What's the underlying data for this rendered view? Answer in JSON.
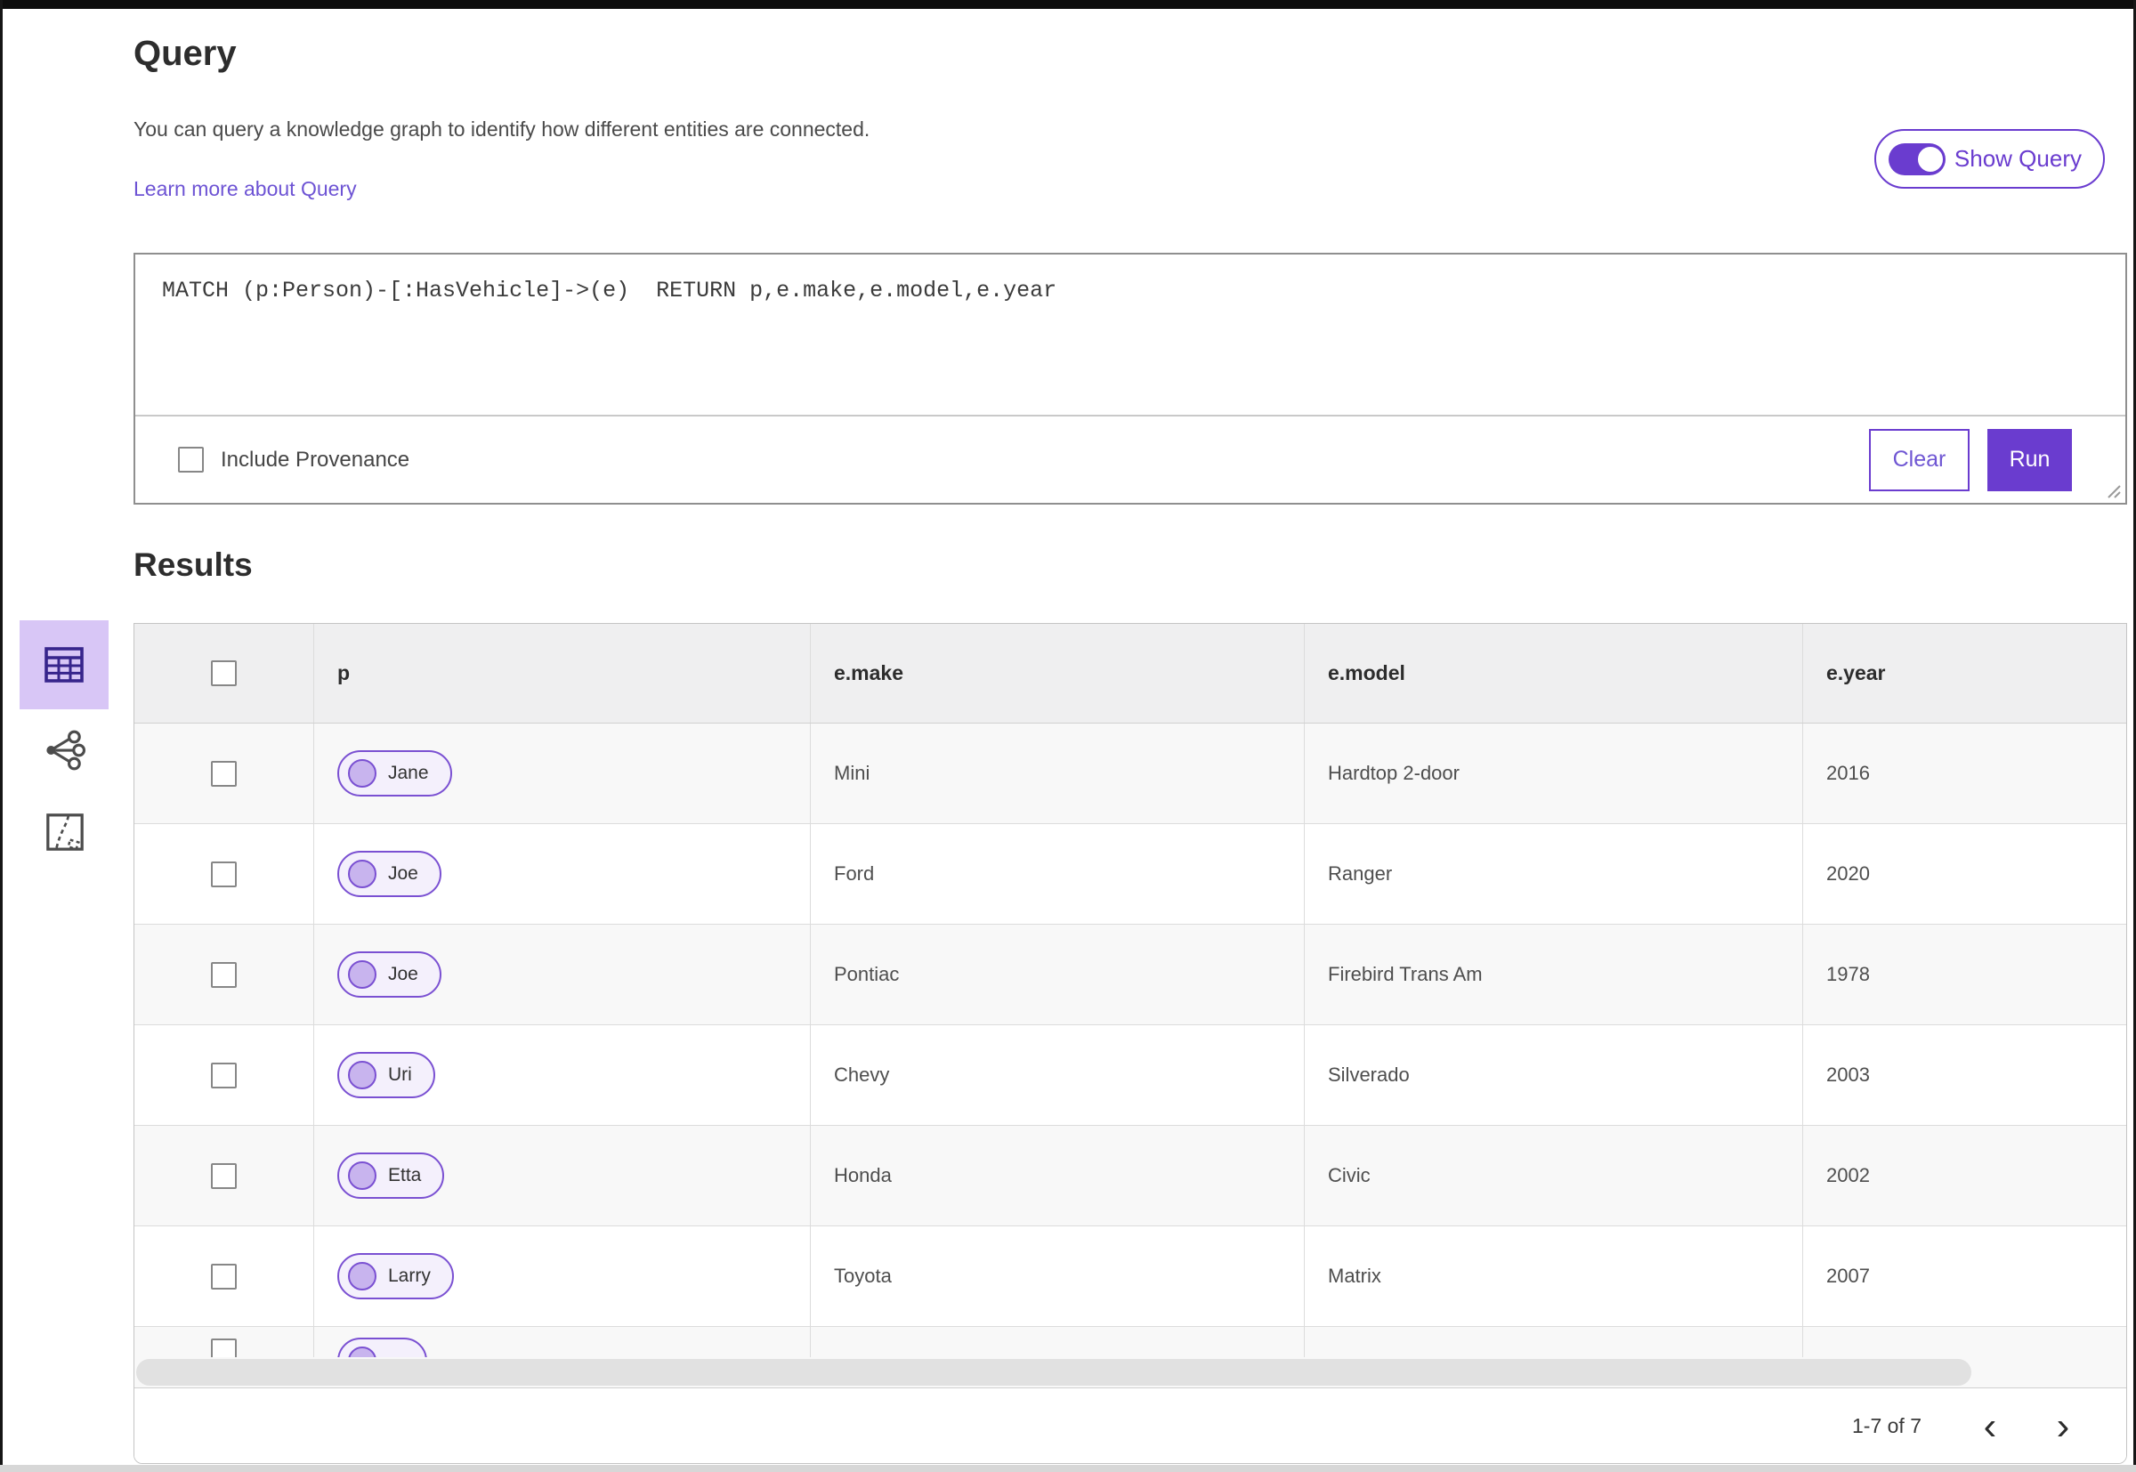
{
  "colors": {
    "accent_purple": "#6a3ccf",
    "pill_border_purple": "#7a50d2",
    "pill_fill": "#f4f0fc",
    "pill_dot_fill": "#c8b4ee",
    "selected_tile_bg": "#d8c6f6",
    "header_bg": "#efeff0",
    "zebra_row_bg": "#f8f8f8"
  },
  "query_panel": {
    "title": "Query",
    "description": "You can query a knowledge graph to identify how different entities are connected.",
    "learn_more_link": "Learn more about Query",
    "show_query_label": "Show Query",
    "show_query_toggle_state": "on",
    "query_text": "MATCH (p:Person)-[:HasVehicle]->(e)  RETURN p,e.make,e.model,e.year",
    "include_provenance_label": "Include Provenance",
    "include_provenance_checked": false,
    "clear_label": "Clear",
    "run_label": "Run"
  },
  "results": {
    "title": "Results",
    "view_rail_icons": [
      "table-view-icon",
      "link-chart-view-icon",
      "map-view-icon"
    ],
    "table": {
      "columns": [
        "p",
        "e.make",
        "e.model",
        "e.year"
      ],
      "rows": [
        {
          "p": "Jane",
          "make": "Mini",
          "model": "Hardtop 2-door",
          "year": "2016"
        },
        {
          "p": "Joe",
          "make": "Ford",
          "model": "Ranger",
          "year": "2020"
        },
        {
          "p": "Joe",
          "make": "Pontiac",
          "model": "Firebird Trans Am",
          "year": "1978"
        },
        {
          "p": "Uri",
          "make": "Chevy",
          "model": "Silverado",
          "year": "2003"
        },
        {
          "p": "Etta",
          "make": "Honda",
          "model": "Civic",
          "year": "2002"
        },
        {
          "p": "Larry",
          "make": "Toyota",
          "model": "Matrix",
          "year": "2007"
        }
      ],
      "partial_seventh_row_visible": true
    },
    "pagination": {
      "range_label": "1-7 of 7",
      "prev_glyph": "‹",
      "next_glyph": "›"
    }
  }
}
